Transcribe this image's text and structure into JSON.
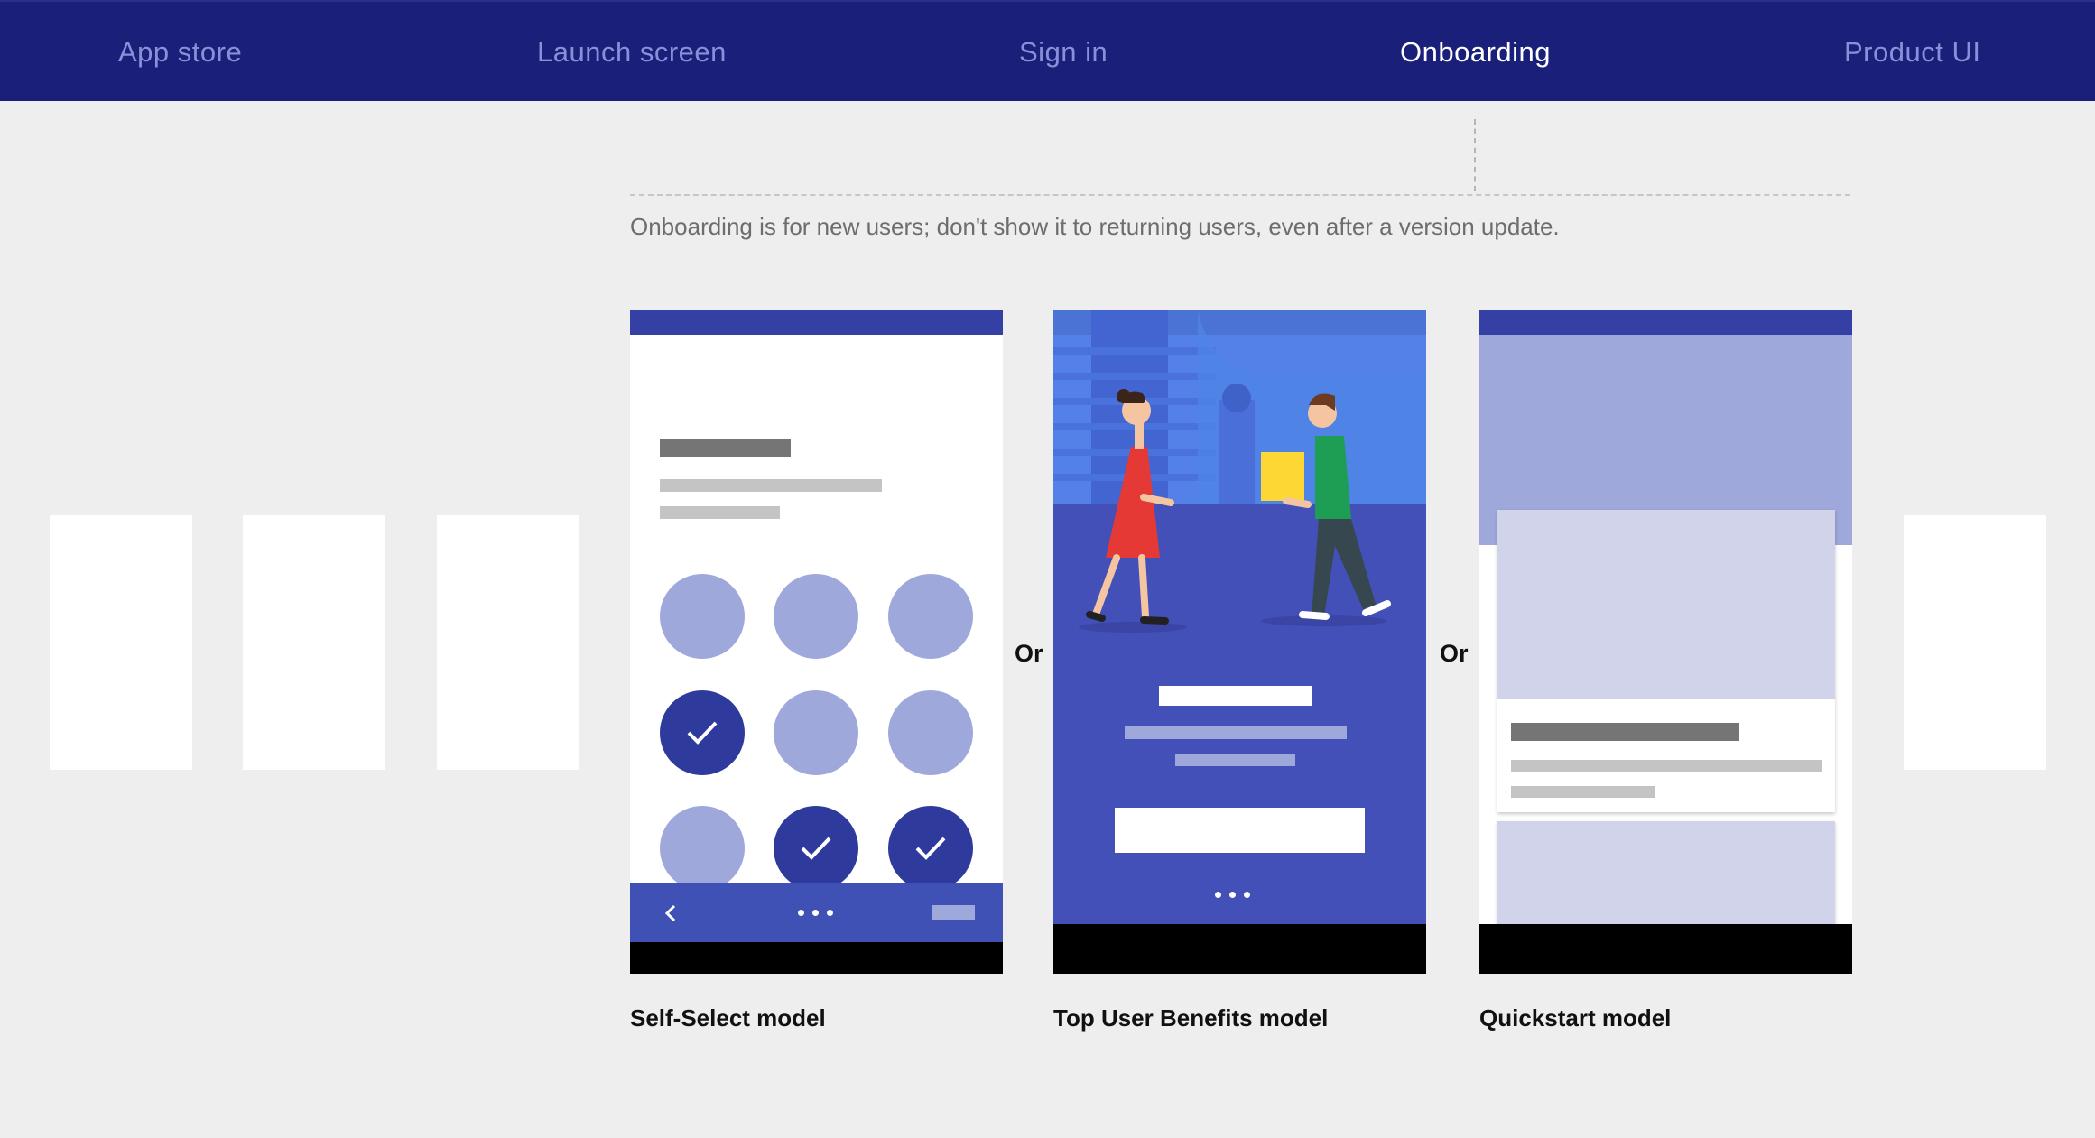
{
  "nav": {
    "items": [
      {
        "label": "App store",
        "active": false
      },
      {
        "label": "Launch screen",
        "active": false
      },
      {
        "label": "Sign in",
        "active": false
      },
      {
        "label": "Onboarding",
        "active": true
      },
      {
        "label": "Product UI",
        "active": false
      }
    ]
  },
  "description": "Onboarding is for new users; don't show it to returning users, even after a version update.",
  "separator_label": "Or",
  "models": [
    {
      "caption": "Self-Select model"
    },
    {
      "caption": "Top User Benefits model"
    },
    {
      "caption": "Quickstart model"
    }
  ],
  "self_select": {
    "selected": [
      false,
      false,
      false,
      true,
      false,
      false,
      false,
      true,
      true
    ]
  },
  "colors": {
    "nav_bg": "#1a1f7a",
    "nav_text": "#8a90d8",
    "nav_active": "#ffffff",
    "background": "#eeeeee",
    "indigo_dark": "#2f3b9c",
    "indigo": "#3f51b5",
    "indigo_light": "#9fa8da",
    "indigo_pale": "#d0d3ea",
    "text_placeholder_dark": "#757575",
    "text_placeholder_light": "#c4c4c4"
  },
  "icons": [
    "check-icon",
    "chevron-left-icon",
    "more-dots-icon"
  ]
}
